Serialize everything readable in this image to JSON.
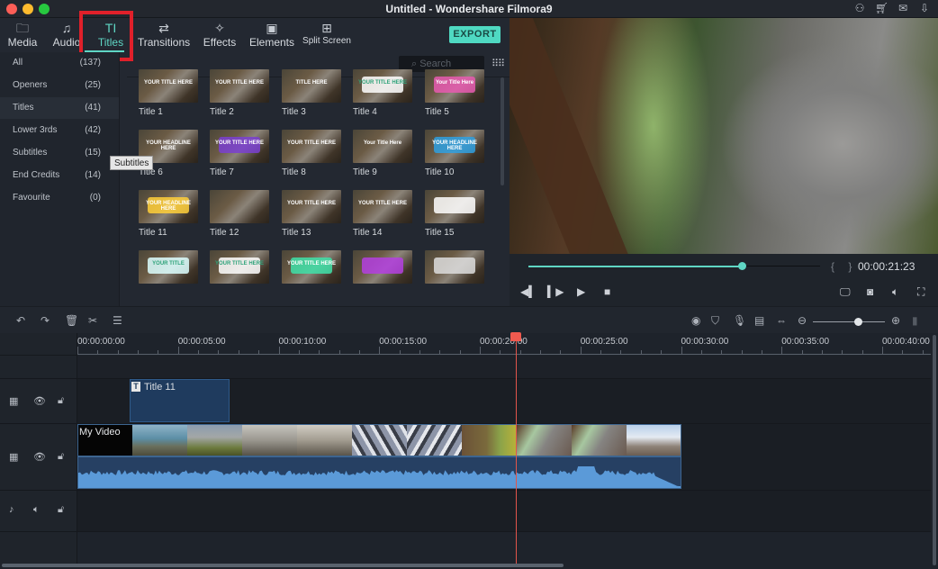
{
  "window": {
    "title": "Untitled - Wondershare Filmora9",
    "titlebar_icons": [
      "user-icon",
      "cart-icon",
      "mail-icon",
      "download-icon"
    ]
  },
  "tabs": [
    {
      "label": "Media",
      "icon": "folder-icon",
      "glyph": "🗀"
    },
    {
      "label": "Audio",
      "icon": "music-note-icon",
      "glyph": "♫"
    },
    {
      "label": "Titles",
      "icon": "text-icon",
      "glyph": "TI",
      "active": true
    },
    {
      "label": "Transitions",
      "icon": "transitions-icon",
      "glyph": "⇄"
    },
    {
      "label": "Effects",
      "icon": "effects-icon",
      "glyph": "✧"
    },
    {
      "label": "Elements",
      "icon": "image-icon",
      "glyph": "▣"
    },
    {
      "label": "Split Screen",
      "icon": "split-screen-icon",
      "glyph": "⊞"
    }
  ],
  "export_label": "EXPORT",
  "categories": [
    {
      "name": "All",
      "count": "(137)"
    },
    {
      "name": "Openers",
      "count": "(25)"
    },
    {
      "name": "Titles",
      "count": "(41)",
      "selected": true
    },
    {
      "name": "Lower 3rds",
      "count": "(42)"
    },
    {
      "name": "Subtitles",
      "count": "(15)"
    },
    {
      "name": "End Credits",
      "count": "(14)"
    },
    {
      "name": "Favourite",
      "count": "(0)"
    }
  ],
  "tooltip": "Subtitles",
  "search": {
    "placeholder": "Search"
  },
  "titles": [
    {
      "label": "Title 1",
      "preview": "YOUR TITLE HERE"
    },
    {
      "label": "Title 2",
      "preview": "YOUR TITLE HERE"
    },
    {
      "label": "Title 3",
      "preview": "TITLE HERE"
    },
    {
      "label": "Title 4",
      "preview": "YOUR TITLE HERE"
    },
    {
      "label": "Title 5",
      "preview": "Your Title Here"
    },
    {
      "label": "Title 6",
      "preview": "YOUR HEADLINE HERE"
    },
    {
      "label": "Title 7",
      "preview": "YOUR TITLE HERE"
    },
    {
      "label": "Title 8",
      "preview": "YOUR TITLE HERE"
    },
    {
      "label": "Title 9",
      "preview": "Your Title Here"
    },
    {
      "label": "Title 10",
      "preview": "YOUR HEADLINE HERE"
    },
    {
      "label": "Title 11",
      "preview": "YOUR HEADLINE HERE"
    },
    {
      "label": "Title 12",
      "preview": ""
    },
    {
      "label": "Title 13",
      "preview": "YOUR TITLE HERE"
    },
    {
      "label": "Title 14",
      "preview": "YOUR TITLE HERE"
    },
    {
      "label": "Title 15",
      "preview": ""
    },
    {
      "label": "",
      "preview": "YOUR TITLE"
    },
    {
      "label": "",
      "preview": "YOUR TITLE HERE"
    },
    {
      "label": "",
      "preview": "YOUR TITLE HERE"
    },
    {
      "label": "",
      "preview": ""
    },
    {
      "label": "",
      "preview": ""
    }
  ],
  "player": {
    "timecode": "00:00:21:23",
    "progress_fraction": 0.73,
    "brackets": "{ }"
  },
  "timeline": {
    "ruler_labels": [
      "00:00:00:00",
      "00:00:05:00",
      "00:00:10:00",
      "00:00:15:00",
      "00:00:20:00",
      "00:00:25:00",
      "00:00:30:00",
      "00:00:35:00",
      "00:00:40:00"
    ],
    "playhead_seconds": 21.8,
    "zoom_fraction": 0.62,
    "title_clip": {
      "label": "Title 11",
      "badge": "T"
    },
    "video_clip": {
      "label": "My Video"
    }
  },
  "colors": {
    "accent": "#5fd6c4",
    "playhead": "#f05a4f",
    "highlight_box": "#e0202a"
  }
}
